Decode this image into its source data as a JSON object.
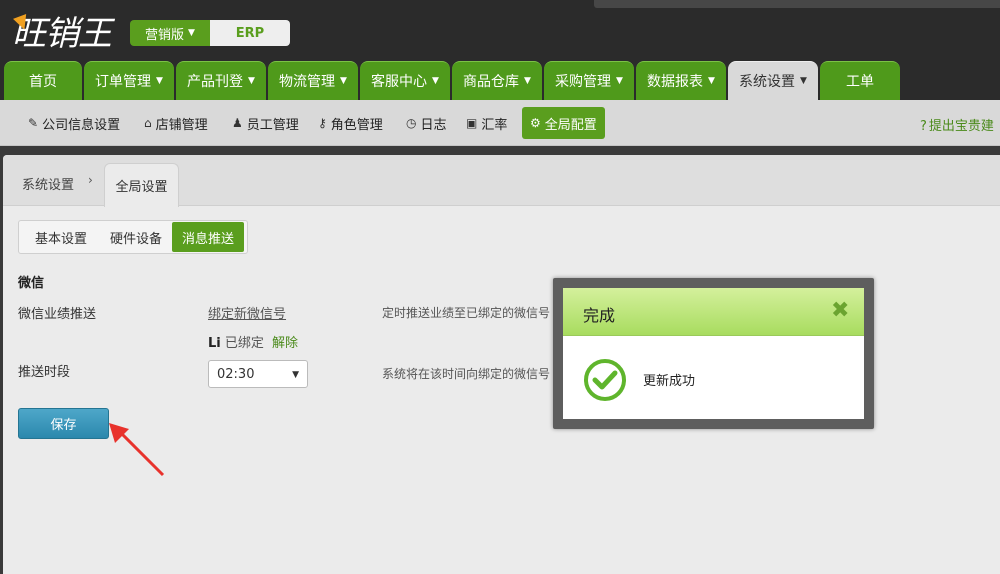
{
  "app": {
    "logo_text": "旺销王",
    "edition_label": "营销版",
    "erp_label": "ERP"
  },
  "nav": {
    "tabs": [
      {
        "label": "首页",
        "has_caret": false
      },
      {
        "label": "订单管理",
        "has_caret": true
      },
      {
        "label": "产品刊登",
        "has_caret": true
      },
      {
        "label": "物流管理",
        "has_caret": true
      },
      {
        "label": "客服中心",
        "has_caret": true
      },
      {
        "label": "商品仓库",
        "has_caret": true
      },
      {
        "label": "采购管理",
        "has_caret": true
      },
      {
        "label": "数据报表",
        "has_caret": true
      },
      {
        "label": "系统设置",
        "has_caret": true,
        "active": true
      },
      {
        "label": "工单",
        "has_caret": false
      }
    ]
  },
  "subnav": {
    "items": [
      {
        "label": "公司信息设置",
        "icon": "edit-icon",
        "glyph": "✎"
      },
      {
        "label": "店铺管理",
        "icon": "home-icon",
        "glyph": "⌂"
      },
      {
        "label": "员工管理",
        "icon": "user-icon",
        "glyph": "♟"
      },
      {
        "label": "角色管理",
        "icon": "key-icon",
        "glyph": "⚷"
      },
      {
        "label": "日志",
        "icon": "clock-icon",
        "glyph": "◷"
      },
      {
        "label": "汇率",
        "icon": "money-icon",
        "glyph": "▣"
      },
      {
        "label": "全局配置",
        "icon": "gear-icon",
        "glyph": "⚙",
        "active": true
      }
    ],
    "help_label": "提出宝贵建"
  },
  "breadcrumb": {
    "parent": "系统设置",
    "separator": "›",
    "current": "全局设置"
  },
  "settings_tabs": {
    "items": [
      {
        "label": "基本设置"
      },
      {
        "label": "硬件设备"
      },
      {
        "label": "消息推送",
        "active": true
      }
    ]
  },
  "wechat": {
    "section_title": "微信",
    "push_label": "微信业绩推送",
    "bind_link": "绑定新微信号",
    "push_desc": "定时推送业绩至已绑定的微信号",
    "bound_user": "Li",
    "bound_status": "已绑定",
    "unbind_label": "解除",
    "period_label": "推送时段",
    "period_value": "02:30",
    "period_desc": "系统将在该时间向绑定的微信号"
  },
  "actions": {
    "save_label": "保存"
  },
  "dialog": {
    "title": "完成",
    "close_glyph": "✖",
    "message": "更新成功"
  },
  "colors": {
    "brand_green": "#5a9e1e",
    "nav_green": "#4f9a1b",
    "save_blue": "#2b88ad",
    "arrow_red": "#e8322c",
    "dialog_header": "#a8dc5f"
  }
}
